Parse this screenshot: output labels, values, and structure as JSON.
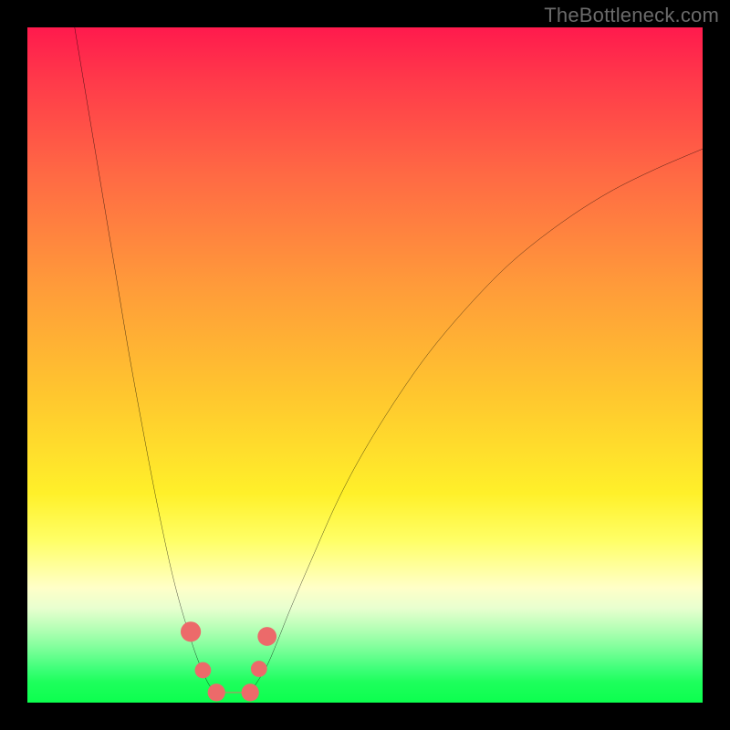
{
  "watermark": "TheBottleneck.com",
  "chart_data": {
    "type": "line",
    "title": "",
    "xlabel": "",
    "ylabel": "",
    "xlim": [
      0,
      100
    ],
    "ylim": [
      0,
      100
    ],
    "series": [
      {
        "name": "left-curve",
        "color": "#000000",
        "x": [
          7.0,
          9.0,
          11.0,
          13.0,
          15.0,
          17.0,
          19.0,
          21.0,
          22.5,
          24.0,
          25.0,
          26.0,
          27.0,
          28.0
        ],
        "y": [
          100.0,
          88.0,
          76.0,
          64.0,
          52.0,
          41.0,
          30.5,
          21.0,
          15.0,
          10.0,
          7.0,
          4.5,
          2.5,
          1.5
        ]
      },
      {
        "name": "right-curve",
        "color": "#000000",
        "x": [
          33.0,
          34.0,
          35.5,
          37.0,
          39.0,
          42.0,
          46.0,
          50.0,
          55.0,
          60.0,
          66.0,
          72.0,
          79.0,
          86.0,
          93.0,
          100.0
        ],
        "y": [
          1.5,
          3.0,
          5.5,
          9.0,
          14.0,
          21.0,
          30.0,
          37.5,
          45.5,
          52.5,
          59.5,
          65.5,
          71.0,
          75.5,
          79.0,
          82.0
        ]
      },
      {
        "name": "bottom-flat",
        "color": "#ec6a6a",
        "x": [
          28.0,
          33.0
        ],
        "y": [
          1.5,
          1.5
        ]
      }
    ],
    "markers": [
      {
        "name": "left-marker-upper",
        "x": 24.2,
        "y": 10.5,
        "color": "#ec6a6a",
        "r": 1.5
      },
      {
        "name": "left-marker-lower",
        "x": 26.0,
        "y": 4.8,
        "color": "#ec6a6a",
        "r": 1.2
      },
      {
        "name": "right-marker-upper",
        "x": 35.5,
        "y": 9.8,
        "color": "#ec6a6a",
        "r": 1.4
      },
      {
        "name": "right-marker-lower",
        "x": 34.3,
        "y": 5.0,
        "color": "#ec6a6a",
        "r": 1.2
      },
      {
        "name": "bottom-left-end",
        "x": 28.0,
        "y": 1.5,
        "color": "#ec6a6a",
        "r": 1.3
      },
      {
        "name": "bottom-right-end",
        "x": 33.0,
        "y": 1.5,
        "color": "#ec6a6a",
        "r": 1.3
      }
    ]
  }
}
